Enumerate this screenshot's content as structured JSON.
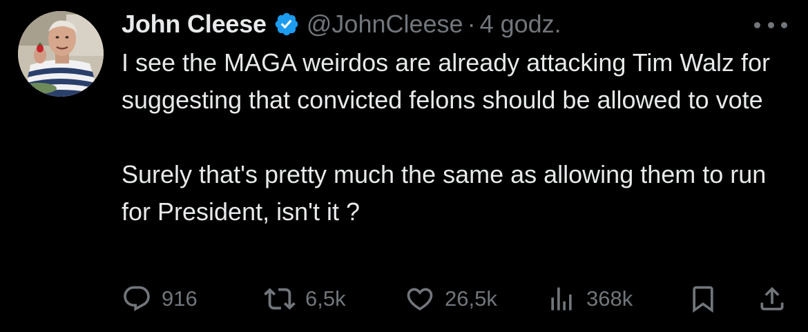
{
  "author": {
    "display_name": "John Cleese",
    "handle": "@JohnCleese",
    "separator": "·",
    "timestamp": "4 godz.",
    "verified": true,
    "avatar_icon": "avatar-photo"
  },
  "tweet": {
    "paragraphs": [
      "I see the MAGA weirdos are already attacking Tim Walz for suggesting that convicted felons should be allowed to vote",
      "Surely that's pretty much the same as allowing them to run for President, isn't it ?"
    ]
  },
  "actions": {
    "replies": "916",
    "reposts": "6,5k",
    "likes": "26,5k",
    "views": "368k"
  },
  "icons": {
    "more": "more-horizontal-icon",
    "reply": "reply-icon",
    "repost": "repost-icon",
    "like": "heart-icon",
    "views": "views-chart-icon",
    "bookmark": "bookmark-icon",
    "share": "share-icon",
    "verified": "verified-badge-icon"
  },
  "colors": {
    "background": "#000000",
    "text": "#e7e9ea",
    "muted": "#71767b",
    "verified": "#1d9bf0"
  }
}
